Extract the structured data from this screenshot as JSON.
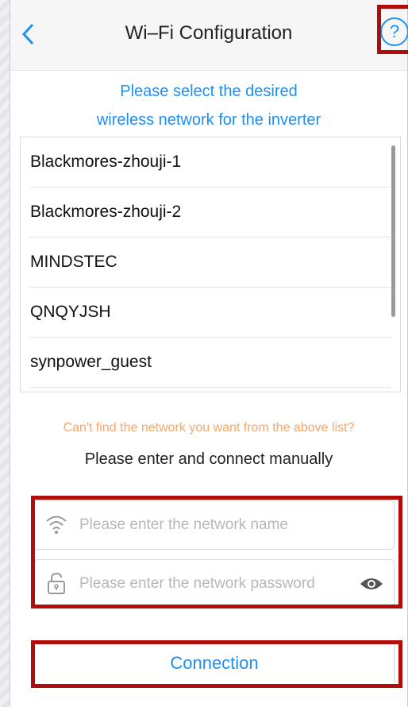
{
  "navbar": {
    "back_icon": "chevron-left-icon",
    "title": "Wi–Fi Configuration",
    "help_icon": "help-circle-icon",
    "help_glyph": "?"
  },
  "prompt": {
    "line1": "Please select the desired",
    "line2": "wireless network for the inverter"
  },
  "networks": [
    "Blackmores-zhouji-1",
    "Blackmores-zhouji-2",
    "MINDSTEC",
    "QNQYJSH",
    "synpower_guest"
  ],
  "hint": "Can't find the network you want from the above list?",
  "manual_label": "Please enter and connect manually",
  "network_name": {
    "placeholder": "Please enter the network name",
    "icon": "wifi-icon"
  },
  "network_password": {
    "placeholder": "Please enter the network password",
    "icon": "lock-icon",
    "toggle_icon": "eye-icon"
  },
  "connect_label": "Connection",
  "colors": {
    "accent": "#1f8ff0",
    "hint": "#f5a66a",
    "highlight": "#b10d0d"
  }
}
